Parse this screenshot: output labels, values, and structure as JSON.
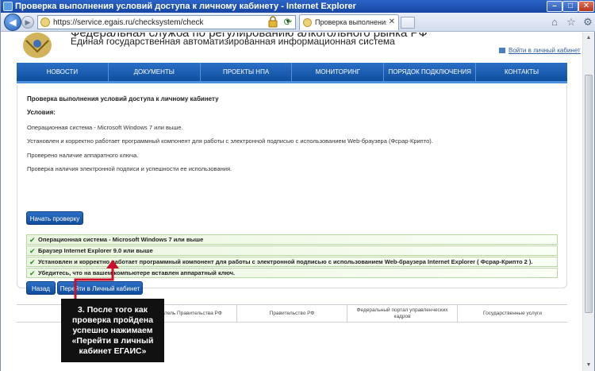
{
  "window": {
    "title": "Проверка выполнения условий доступа к личному кабинету - Internet Explorer"
  },
  "toolbar": {
    "address": "https://service.egais.ru/checksystem/check",
    "tab_label": "Проверка выполнения усло..."
  },
  "header": {
    "org_title": "Федеральная служба по регулированию алкогольного рынка РФ",
    "org_subtitle": "Единая государственная автоматизированная информационная система",
    "login_link": "Войти в личный кабинет"
  },
  "nav": {
    "items": [
      "НОВОСТИ",
      "ДОКУМЕНТЫ",
      "ПРОЕКТЫ НПА",
      "МОНИТОРИНГ",
      "ПОРЯДОК ПОДКЛЮЧЕНИЯ",
      "КОНТАКТЫ"
    ]
  },
  "content": {
    "title": "Проверка выполнения условий доступа к личному кабинету",
    "conditions_label": "Условия:",
    "conditions": [
      "Операционная система - Microsoft Windows 7 или выше.",
      "Установлен и корректно работает программный компонент для работы с электронной подписью с использованием Web-браузера (Фсрар-Крипто).",
      "Проверено наличие аппаратного ключа.",
      "Проверка наличия электронной подписи и успешности ее использования."
    ],
    "start_button": "Начать проверку",
    "checks": [
      "Операционная система - Microsoft Windows 7 или выше",
      "Браузер Internet Explorer 9.0 или выше",
      "Установлен и корректно работает программный компонент для работы с электронной подписью с использованием Web-браузера Internet Explorer ( Фсрар-Крипто 2 ).",
      "Убедитесь, что на вашем компьютере вставлен аппаратный ключ."
    ],
    "back_button": "Назад",
    "go_button": "Перейти в Личный кабинет"
  },
  "footer": {
    "items": [
      "Пре...",
      "Председатель Правительства РФ",
      "Правительство РФ",
      "Федеральный портал управленческих кадров",
      "Государственные услуги"
    ]
  },
  "annotation": {
    "text": "3. После того как проверка пройдена успешно нажимаем «Перейти в личный кабинет ЕГАИС»",
    "color": "#c8102e"
  }
}
